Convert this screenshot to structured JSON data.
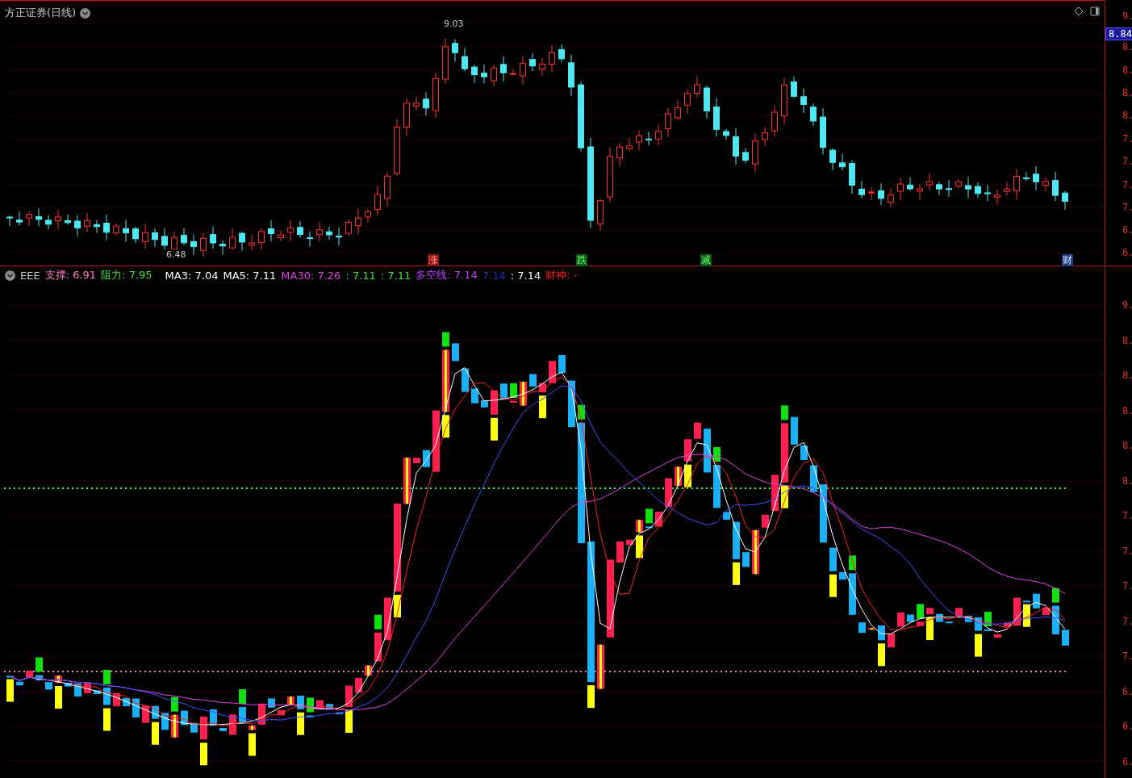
{
  "price_panel": {
    "title": "方正证券(日线)",
    "axis_labels": [
      "9.",
      "8.",
      "8.",
      "8.",
      "8.",
      "7.",
      "7.",
      "7.",
      "7.",
      "6.",
      "6."
    ],
    "current_price": "8.84",
    "high_label": "9.03",
    "low_label": "6.48",
    "events": [
      {
        "label": "涨",
        "color": "#8a1010"
      },
      {
        "label": "跌",
        "color": "#0c5a14"
      },
      {
        "label": "减",
        "color": "#0c5a14"
      },
      {
        "label": "财",
        "color": "#1c3f7a"
      }
    ]
  },
  "indicator_panel": {
    "legend": [
      {
        "label": "EEE",
        "color": "#c8c8c8"
      },
      {
        "label": "支撑: 6.91",
        "color": "#ff80c0"
      },
      {
        "label": "阻力: 7.95",
        "color": "#40e040"
      },
      {
        "label": "MA3: 7.04",
        "color": "#ffffff"
      },
      {
        "label": "MA5: 7.11",
        "color": "#ffffff"
      },
      {
        "label": "MA30: 7.26",
        "color": "#e040e0"
      },
      {
        "label": ": 7.11",
        "color": "#40e040"
      },
      {
        "label": ": 7.11",
        "color": "#40e040"
      },
      {
        "label": "多空线: 7.14",
        "color": "#c040ff"
      },
      {
        "label": "7.14",
        "color": "#2030c0"
      },
      {
        "label": ": 7.14",
        "color": "#ffffff"
      },
      {
        "label": "财神: -",
        "color": "#ff2020"
      }
    ],
    "axis_labels": [
      "9.",
      "8.",
      "8.",
      "8.",
      "8.",
      "8.",
      "7.",
      "7.",
      "7.",
      "7.",
      "7.",
      "6.",
      "6.",
      "6."
    ]
  }
}
